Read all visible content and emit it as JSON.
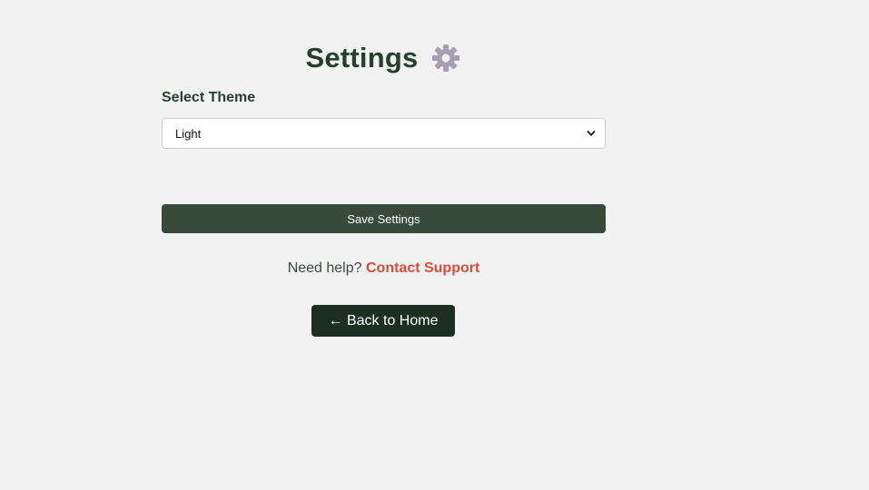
{
  "header": {
    "title": "Settings",
    "icon": "gear-icon",
    "icon_color": "#a79fb0"
  },
  "theme": {
    "label": "Select Theme",
    "selected": "Light"
  },
  "actions": {
    "save_label": "Save Settings"
  },
  "help": {
    "text": "Need help?",
    "link_label": "Contact Support",
    "link_color": "#d94b3f"
  },
  "nav": {
    "back_label": "← Back to Home"
  },
  "colors": {
    "primary_dark": "#27402d",
    "save_bg": "#374a3b",
    "back_bg": "#1c2f21",
    "page_bg": "#f2f2f2"
  }
}
